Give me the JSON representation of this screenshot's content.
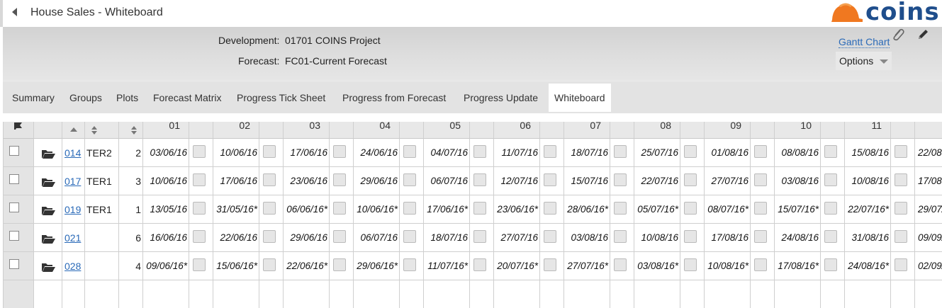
{
  "window": {
    "title": "House Sales - Whiteboard",
    "logo_text": "coins",
    "brand_color": "#1f4e8c",
    "accent_orange": "#f07820"
  },
  "header": {
    "development_label": "Development:",
    "development_value": "01701 COINS Project",
    "forecast_label": "Forecast:",
    "forecast_value": "FC01-Current Forecast",
    "gantt_link": "Gantt Chart",
    "options_label": "Options"
  },
  "tabs": [
    {
      "label": "Summary",
      "active": false
    },
    {
      "label": "Groups",
      "active": false
    },
    {
      "label": "Plots",
      "active": false
    },
    {
      "label": "Forecast Matrix",
      "active": false
    },
    {
      "label": "Progress Tick Sheet",
      "active": false
    },
    {
      "label": "Progress from Forecast",
      "active": false
    },
    {
      "label": "Progress Update",
      "active": false
    },
    {
      "label": "Whiteboard",
      "active": true
    }
  ],
  "grid": {
    "columns": [
      "01",
      "02",
      "03",
      "04",
      "05",
      "06",
      "07",
      "08",
      "09",
      "10",
      "11"
    ],
    "rows": [
      {
        "plot": "014",
        "group": "TER2",
        "qty": "2",
        "dates": [
          "03/06/16",
          "10/06/16",
          "17/06/16",
          "24/06/16",
          "04/07/16",
          "11/07/16",
          "18/07/16",
          "25/07/16",
          "01/08/16",
          "08/08/16",
          "15/08/16",
          "22/08"
        ]
      },
      {
        "plot": "017",
        "group": "TER1",
        "qty": "3",
        "dates": [
          "10/06/16",
          "17/06/16",
          "23/06/16",
          "29/06/16",
          "06/07/16",
          "12/07/16",
          "15/07/16",
          "22/07/16",
          "27/07/16",
          "03/08/16",
          "10/08/16",
          "17/08"
        ]
      },
      {
        "plot": "019",
        "group": "TER1",
        "qty": "1",
        "dates": [
          "13/05/16",
          "31/05/16*",
          "06/06/16*",
          "10/06/16*",
          "17/06/16*",
          "23/06/16*",
          "28/06/16*",
          "05/07/16*",
          "08/07/16*",
          "15/07/16*",
          "22/07/16*",
          "29/07/"
        ]
      },
      {
        "plot": "021",
        "group": "",
        "qty": "6",
        "dates": [
          "16/06/16",
          "22/06/16",
          "29/06/16",
          "06/07/16",
          "18/07/16",
          "27/07/16",
          "03/08/16",
          "10/08/16",
          "17/08/16",
          "24/08/16",
          "31/08/16",
          "09/09/"
        ]
      },
      {
        "plot": "028",
        "group": "",
        "qty": "4",
        "dates": [
          "09/06/16*",
          "15/06/16*",
          "22/06/16*",
          "29/06/16*",
          "11/07/16*",
          "20/07/16*",
          "27/07/16*",
          "03/08/16*",
          "10/08/16*",
          "17/08/16*",
          "24/08/16*",
          "02/09/"
        ]
      }
    ]
  }
}
